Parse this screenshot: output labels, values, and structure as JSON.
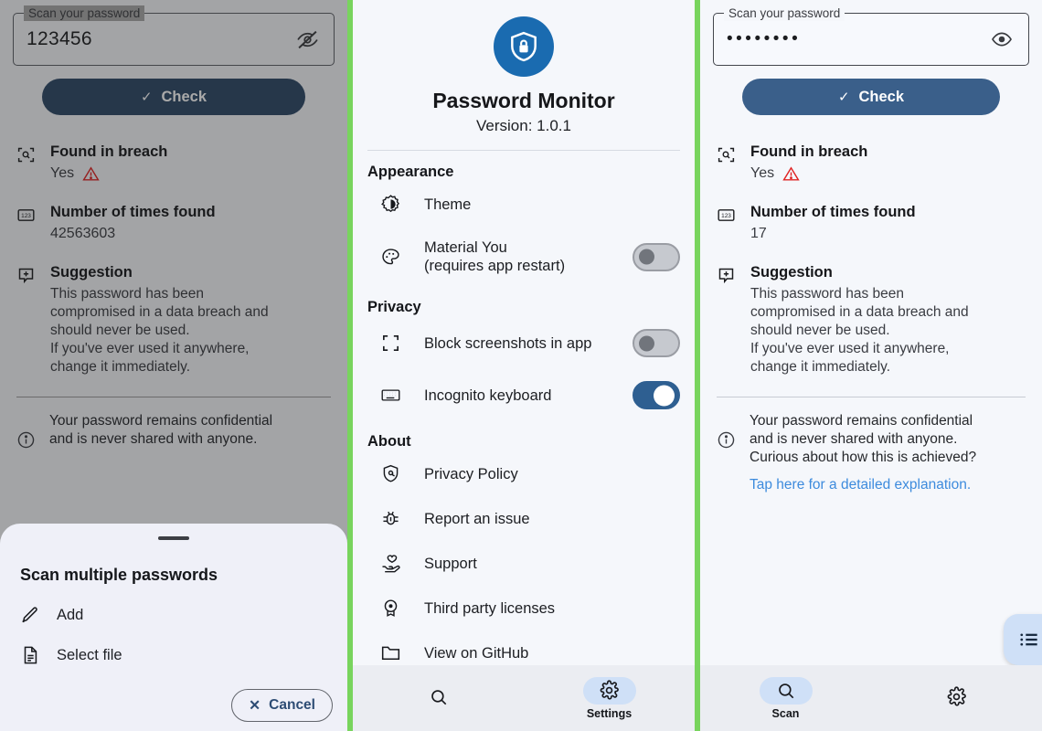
{
  "app": {
    "name": "Password Monitor",
    "version_label": "Version: 1.0.1"
  },
  "theme": {
    "accent": "#2c4766",
    "accent_right": "#3a5f8a",
    "divider_green": "#78d45d",
    "link_blue": "#3d8bdd",
    "warning_red": "#e02424",
    "pill_blue": "#cfe0f7",
    "toggle_on": "#2e5f91",
    "logo_blue": "#1a6bb0"
  },
  "left_panel": {
    "field": {
      "legend": "Scan your password",
      "value": "123456",
      "placeholder": "Scan your password",
      "visibility_icon": "eye-off-icon"
    },
    "check_button": "Check",
    "results": [
      {
        "icon": "breach-scan-icon",
        "title": "Found in breach",
        "value": "Yes",
        "has_warning": true
      },
      {
        "icon": "number-123-icon",
        "title": "Number of times found",
        "value": "42563603",
        "has_warning": false
      },
      {
        "icon": "suggestion-icon",
        "title": "Suggestion",
        "value": "This password has been\ncompromised in a data breach and\nshould never be used.\nIf you've ever used it anywhere,\nchange it immediately.",
        "has_warning": false
      }
    ],
    "note": {
      "icon": "info-icon",
      "text": "Your password remains confidential\nand is never shared with anyone."
    },
    "sheet": {
      "title": "Scan multiple passwords",
      "items": [
        {
          "icon": "pencil-icon",
          "label": "Add"
        },
        {
          "icon": "file-icon",
          "label": "Select file"
        }
      ],
      "cancel_label": "Cancel"
    }
  },
  "mid_panel": {
    "groups": [
      {
        "title": "Appearance",
        "rows": [
          {
            "icon": "brightness-icon",
            "label": "Theme",
            "toggle": null
          },
          {
            "icon": "palette-icon",
            "label": "Material You\n(requires app restart)",
            "toggle": "off"
          }
        ]
      },
      {
        "title": "Privacy",
        "rows": [
          {
            "icon": "block-screenshot-icon",
            "label": "Block screenshots in app",
            "toggle": "off"
          },
          {
            "icon": "keyboard-icon",
            "label": "Incognito keyboard",
            "toggle": "on"
          }
        ]
      },
      {
        "title": "About",
        "rows": [
          {
            "icon": "privacy-shield-icon",
            "label": "Privacy Policy",
            "toggle": null
          },
          {
            "icon": "bug-icon",
            "label": "Report an issue",
            "toggle": null
          },
          {
            "icon": "support-heart-icon",
            "label": "Support",
            "toggle": null
          },
          {
            "icon": "license-badge-icon",
            "label": "Third party licenses",
            "toggle": null
          },
          {
            "icon": "folder-icon",
            "label": "View on GitHub",
            "toggle": null
          }
        ]
      }
    ],
    "bottom_nav": [
      {
        "icon": "search-icon",
        "label": "",
        "active": false
      },
      {
        "icon": "gear-icon",
        "label": "Settings",
        "active": true
      }
    ]
  },
  "right_panel": {
    "field": {
      "legend": "Scan your password",
      "value": "••••••••",
      "placeholder": "Scan your password",
      "visibility_icon": "eye-icon"
    },
    "check_button": "Check",
    "results": [
      {
        "icon": "breach-scan-icon",
        "title": "Found in breach",
        "value": "Yes",
        "has_warning": true
      },
      {
        "icon": "number-123-icon",
        "title": "Number of times found",
        "value": "17",
        "has_warning": false
      },
      {
        "icon": "suggestion-icon",
        "title": "Suggestion",
        "value": "This password has been\ncompromised in a data breach and\nshould never be used.\nIf you've ever used it anywhere,\nchange it immediately.",
        "has_warning": false
      }
    ],
    "note": {
      "icon": "info-icon",
      "text": "Your password remains confidential\nand is never shared with anyone.\nCurious about how this is achieved?",
      "link": "Tap here for a detailed explanation."
    },
    "fab": {
      "icon": "list-icon"
    },
    "bottom_nav": [
      {
        "icon": "search-icon",
        "label": "Scan",
        "active": true
      },
      {
        "icon": "gear-icon",
        "label": "",
        "active": false
      }
    ]
  }
}
